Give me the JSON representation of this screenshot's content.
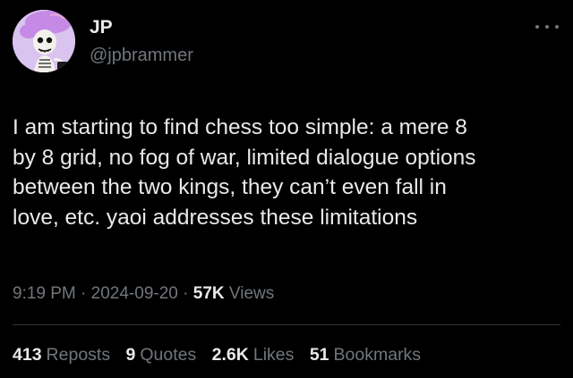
{
  "author": {
    "name": "JP",
    "handle": "@jpbrammer",
    "avatar_icon": "skeleton-avatar-icon"
  },
  "more_icon": "more-horizontal-icon",
  "tweet": {
    "text": "I am starting to find chess too simple: a mere 8\nby 8 grid, no fog of war, limited dialogue options\nbetween the two kings, they can’t even fall in\nlove, etc. yaoi addresses these limitations"
  },
  "meta": {
    "time": "9:19 PM",
    "separator": "·",
    "date": "2024-09-20",
    "views_count": "57K",
    "views_label": "Views"
  },
  "stats": {
    "reposts": {
      "count": "413",
      "label": "Reposts"
    },
    "quotes": {
      "count": "9",
      "label": "Quotes"
    },
    "likes": {
      "count": "2.6K",
      "label": "Likes"
    },
    "bookmarks": {
      "count": "51",
      "label": "Bookmarks"
    }
  },
  "colors": {
    "background": "#000000",
    "primary_text": "#e7e9ea",
    "secondary_text": "#71767b",
    "divider": "#2f3336",
    "avatar_bg": "#d9c3ef"
  }
}
